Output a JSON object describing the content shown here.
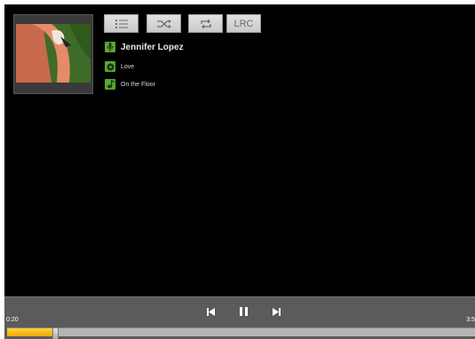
{
  "mode_buttons": {
    "playlist_icon": "playlist-icon",
    "shuffle_icon": "shuffle-icon",
    "repeat_icon": "repeat-icon",
    "lrc_label": "LRC"
  },
  "track": {
    "artist": "Jennifer Lopez",
    "album": "Love",
    "title": "On the Floor"
  },
  "playback": {
    "elapsed": "0:20",
    "total": "3:5",
    "progress": 0.1
  },
  "colors": {
    "background": "#000000",
    "accent_green": "#5aa532",
    "progress_fill": "#f5b400",
    "control_bar": "#5b5b5b"
  }
}
